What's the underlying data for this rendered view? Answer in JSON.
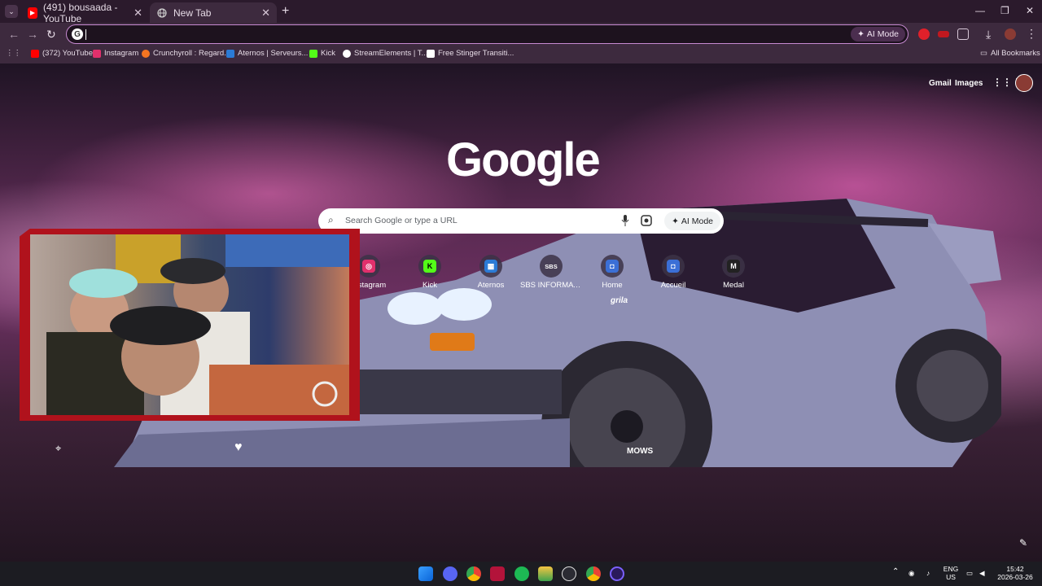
{
  "browser": {
    "tabs": [
      {
        "title": "(491) bousaada - YouTube",
        "icon": "youtube-icon",
        "color": "#ff0000"
      },
      {
        "title": "New Tab",
        "icon": "globe-icon",
        "color": "#a0a0a0"
      }
    ],
    "new_tab_symbol": "+",
    "window_controls": {
      "minimize": "—",
      "maximize": "❐",
      "close": "✕"
    },
    "omnibox": {
      "value": "",
      "g_letter": "G",
      "ai_mode_label": "AI Mode"
    },
    "bookmarks": [
      {
        "label": "(372) YouTube",
        "color": "#ff0000"
      },
      {
        "label": "Instagram",
        "color": "#e1306c"
      },
      {
        "label": "Crunchyroll : Regard...",
        "color": "#f47521"
      },
      {
        "label": "Aternos | Serveurs...",
        "color": "#2b7bd6"
      },
      {
        "label": "Kick",
        "color": "#53fc18"
      },
      {
        "label": "StreamElements | T...",
        "color": "#ffffff"
      },
      {
        "label": "Free Stinger Transiti...",
        "color": "#ffffff"
      }
    ],
    "all_bookmarks_label": "All Bookmarks"
  },
  "ntp": {
    "top_links": {
      "gmail": "Gmail",
      "images": "Images"
    },
    "logo": "Google",
    "search": {
      "placeholder": "Search Google or type a URL",
      "ai_mode_label": "AI Mode"
    },
    "shortcuts": [
      {
        "label": "Instagram",
        "glyph": "◎",
        "color": "#e1306c"
      },
      {
        "label": "Kick",
        "glyph": "K",
        "color": "#53fc18"
      },
      {
        "label": "Aternos",
        "glyph": "▦",
        "color": "#2b7bd6"
      },
      {
        "label": "SBS INFORMATI...",
        "glyph": "SBS",
        "color": "#444444"
      },
      {
        "label": "Home",
        "glyph": "◘",
        "color": "#3b6fd6"
      },
      {
        "label": "Accueil",
        "glyph": "◘",
        "color": "#3b6fd6"
      },
      {
        "label": "Medal",
        "glyph": "M",
        "color": "#222222"
      }
    ],
    "car_text": {
      "windshield": "grila",
      "tire": "MOWS"
    }
  },
  "taskbar": {
    "language": "ENG",
    "region": "US",
    "time": "15:42",
    "date": "2026-03-26"
  }
}
